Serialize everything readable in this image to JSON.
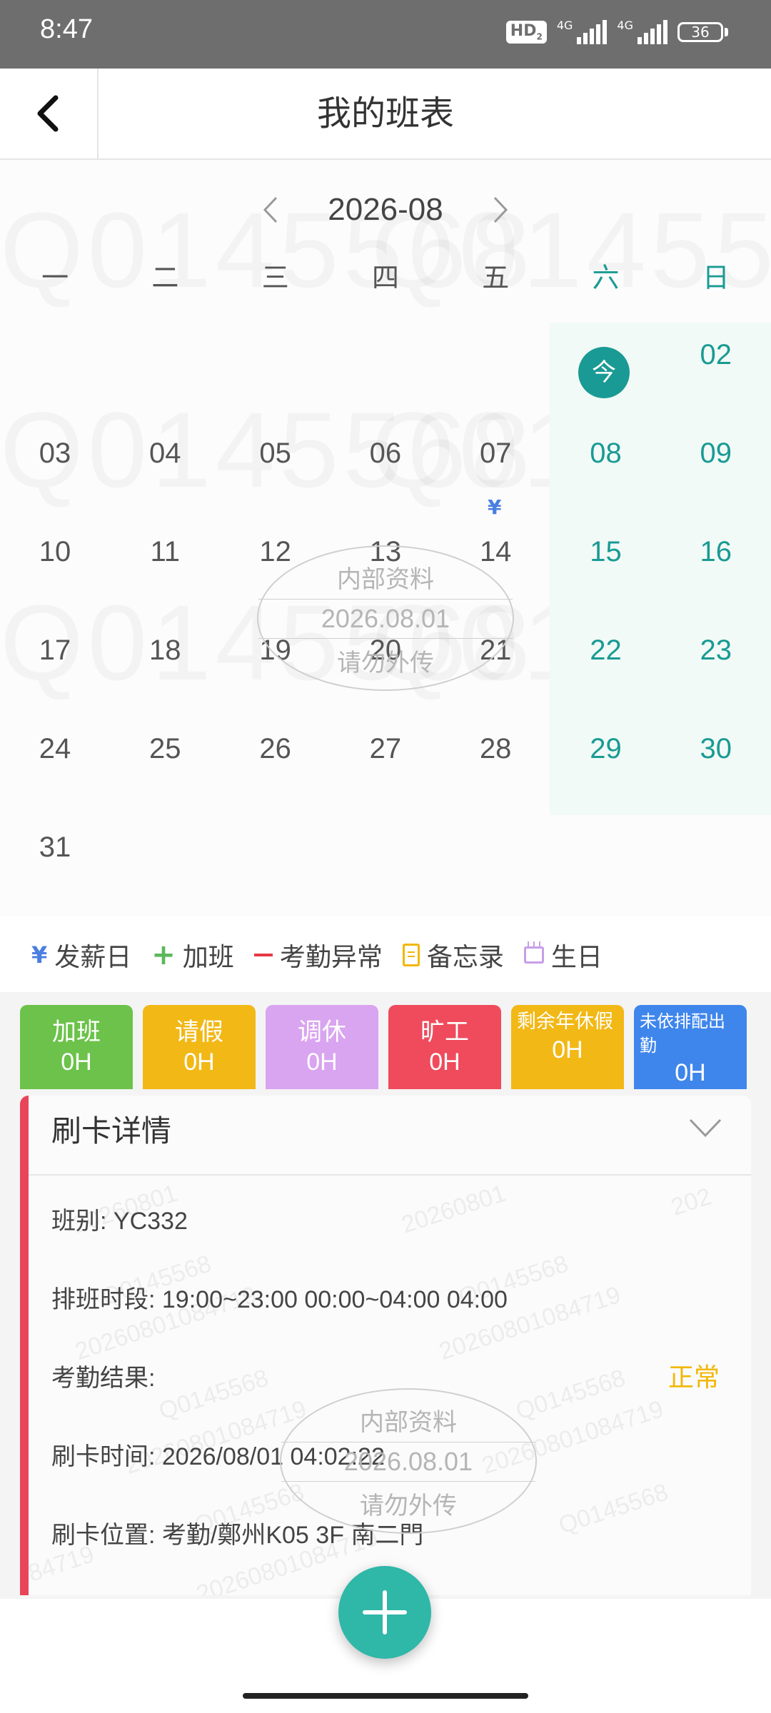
{
  "status_bar": {
    "time": "8:47",
    "network_badge": "HD",
    "network_badge_sub": "2",
    "signal1_label": "4G",
    "signal2_label": "4G",
    "battery": "36"
  },
  "header": {
    "title": "我的班表",
    "back_icon": "chevron-left-icon"
  },
  "calendar": {
    "month": "2026-08",
    "weekdays": [
      "一",
      "二",
      "三",
      "四",
      "五",
      "六",
      "日"
    ],
    "today_label": "今",
    "days": [
      "02",
      "03",
      "04",
      "05",
      "06",
      "07",
      "08",
      "09",
      "10",
      "11",
      "12",
      "13",
      "14",
      "15",
      "16",
      "17",
      "18",
      "19",
      "20",
      "21",
      "22",
      "23",
      "24",
      "25",
      "26",
      "27",
      "28",
      "29",
      "30",
      "31"
    ],
    "payday_mark": "¥",
    "accent_color": "#1a9a94"
  },
  "watermark": {
    "stamp_line1": "内部资料",
    "stamp_line2": "2026.08.01",
    "stamp_line3": "请勿外传",
    "background_text": "Q0145568",
    "card_id": "Q0145568",
    "card_code": "20260801084719",
    "card_date": "20260801",
    "card_code_tail": "084719",
    "card_year": "202"
  },
  "legend": {
    "payday": "发薪日",
    "overtime": "加班",
    "attendance_abnormal": "考勤异常",
    "memo": "备忘录",
    "birthday": "生日"
  },
  "stats": [
    {
      "label": "加班",
      "value": "0H",
      "color": "#6cc24a"
    },
    {
      "label": "请假",
      "value": "0H",
      "color": "#f2b816"
    },
    {
      "label": "调休",
      "value": "0H",
      "color": "#d9a4f0"
    },
    {
      "label": "旷工",
      "value": "0H",
      "color": "#ef4b5c"
    },
    {
      "label": "剩余年休假",
      "value": "0H",
      "color": "#f2b816"
    },
    {
      "label": "未依排配出勤",
      "value": "0H",
      "color": "#3f86ec"
    }
  ],
  "detail": {
    "title": "刷卡详情",
    "shift": "班别: YC332",
    "schedule": "排班时段: 19:00~23:00 00:00~04:00 04:00",
    "result_label": "考勤结果:",
    "result_value": "正常",
    "swipe_time": "刷卡时间: 2026/08/01 04:02:22",
    "swipe_location": "刷卡位置: 考勤/鄭州K05 3F 南二門"
  },
  "fab": {
    "icon": "plus-icon"
  }
}
